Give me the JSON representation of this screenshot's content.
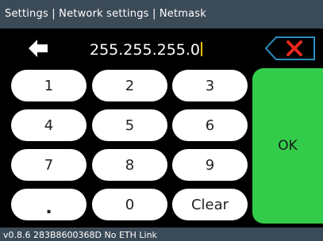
{
  "header": {
    "breadcrumb": "Settings | Network settings | Netmask"
  },
  "input": {
    "value": "255.255.255.0"
  },
  "keypad": {
    "keys": [
      "1",
      "2",
      "3",
      "4",
      "5",
      "6",
      "7",
      "8",
      "9",
      ".",
      "0",
      "Clear"
    ],
    "ok_label": "OK"
  },
  "icons": {
    "back": "left-arrow-icon",
    "delete": "backspace-x-icon"
  },
  "colors": {
    "header_bg": "#3b4a57",
    "ok_green": "#33cc4a",
    "delete_red": "#e8281e",
    "cursor": "#f2c200"
  },
  "footer": {
    "status": "v0.8.6  283B8600368D  No ETH Link"
  }
}
